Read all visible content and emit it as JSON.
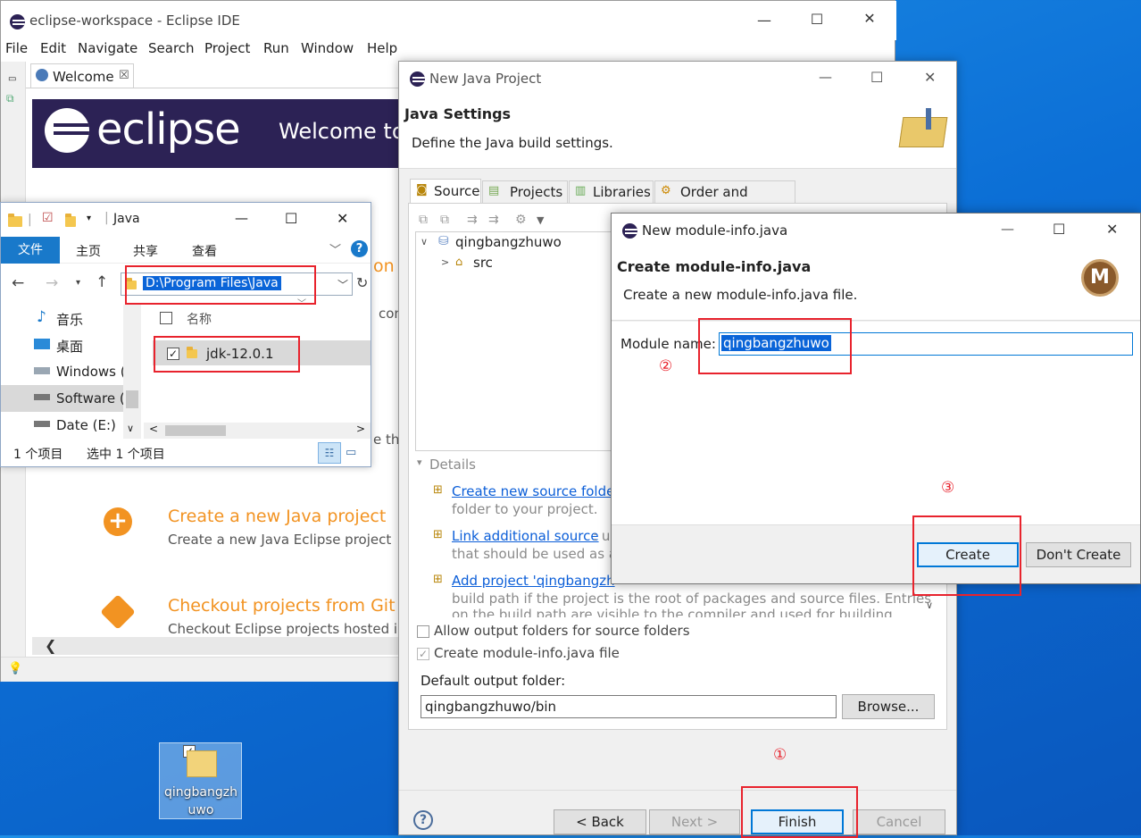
{
  "eclipse": {
    "title": "eclipse-workspace - Eclipse IDE",
    "menu": [
      "File",
      "Edit",
      "Navigate",
      "Search",
      "Project",
      "Run",
      "Window",
      "Help"
    ],
    "tab_label": "Welcome",
    "tab_close": "☒",
    "banner_logo_text": "eclipse",
    "banner_welcome": "Welcome to",
    "partial_texts": {
      "on": "on",
      "con": "con",
      "the": "e th"
    },
    "items": [
      {
        "title": "Create a new Java project",
        "desc": "Create a new Java Eclipse project"
      },
      {
        "title": "Checkout projects from Git",
        "desc": "Checkout Eclipse projects hosted i"
      }
    ]
  },
  "explorer": {
    "title": "Java",
    "ribbon": {
      "file": "文件",
      "home": "主页",
      "share": "共享",
      "view": "查看"
    },
    "address": "D:\\Program Files\\Java",
    "nav_items": [
      "音乐",
      "桌面",
      "Windows (",
      "Software (",
      "Date (E:)"
    ],
    "column_name": "名称",
    "file_item": "jdk-12.0.1",
    "status_count": "1 个项目",
    "status_selected": "选中 1 个项目"
  },
  "new_java_project": {
    "title": "New Java Project",
    "heading": "Java Settings",
    "subheading": "Define the Java build settings.",
    "tabs": [
      "Source",
      "Projects",
      "Libraries",
      "Order and Export"
    ],
    "tree_project": "qingbangzhuwo",
    "tree_src": "src",
    "details_label": "Details",
    "details": [
      {
        "link": "Create new source folde",
        "rest": "folder to your project."
      },
      {
        "link": "Link additional source",
        "rest_first": ": u",
        "rest": "that should be used as a"
      },
      {
        "link": "Add project 'qingbangzh",
        "rest": "build path if the project is the root of packages and source files. Entries",
        "rest2": "on the build path are visible to the compiler and used for building"
      }
    ],
    "allow_output": "Allow output folders for source folders",
    "create_module": "Create module-info.java file",
    "default_output_label": "Default output folder:",
    "default_output_value": "qingbangzhuwo/bin",
    "browse": "Browse...",
    "back": "< Back",
    "next": "Next >",
    "finish": "Finish",
    "cancel": "Cancel"
  },
  "module_dialog": {
    "title": "New module-info.java",
    "heading": "Create module-info.java",
    "subheading": "Create a new module-info.java file.",
    "module_label": "Module name:",
    "module_value": "qingbangzhuwo",
    "create": "Create",
    "dont_create": "Don't Create"
  },
  "annotations": {
    "one": "①",
    "two": "②",
    "three": "③"
  },
  "desktop_icon": {
    "label": "qingbangzhuwo"
  },
  "colors": {
    "accent_red": "#e8232d",
    "eclipse_purple": "#2c2255",
    "eclipse_orange": "#f29322",
    "win_blue": "#0078d7"
  }
}
